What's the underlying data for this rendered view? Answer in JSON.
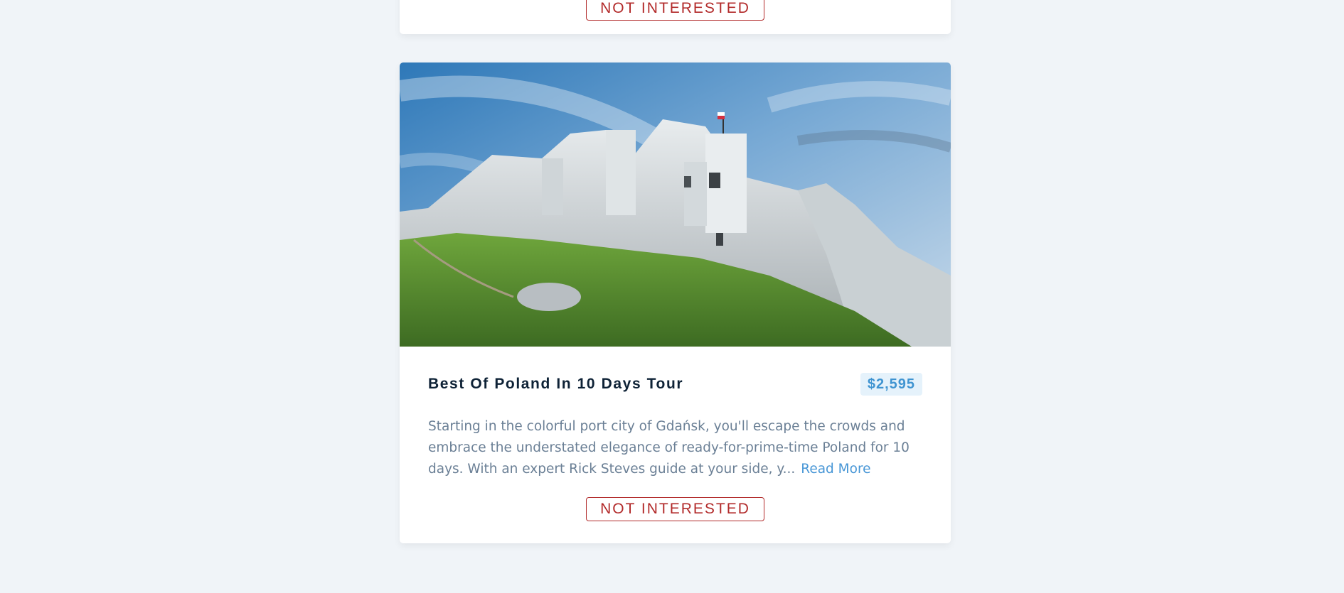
{
  "cards": [
    {
      "not_interested_label": "NOT INTERESTED"
    },
    {
      "title": "Best Of Poland In 10 Days Tour",
      "price": "$2,595",
      "description": "Starting in the colorful port city of Gdańsk, you'll escape the crowds and embrace the understated elegance of ready-for-prime-time Poland for 10 days. With an expert Rick Steves guide at your side, y...",
      "read_more_label": "Read More",
      "not_interested_label": "NOT INTERESTED"
    }
  ],
  "colors": {
    "background": "#f0f4f8",
    "title": "#0e2236",
    "price_text": "#3f94d1",
    "price_bg": "#e5f2fb",
    "description": "#6a7f95",
    "link": "#4796d6",
    "danger": "#b22a2a"
  }
}
